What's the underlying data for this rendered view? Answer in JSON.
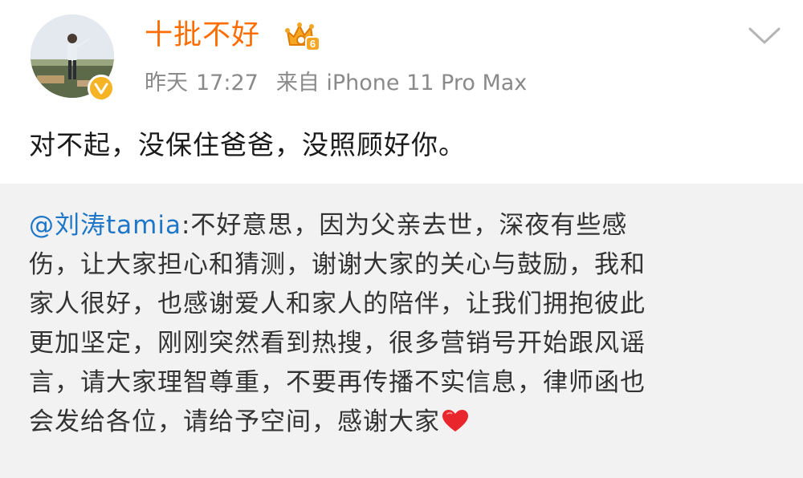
{
  "author": {
    "name": "十批不好",
    "vip_level": "6",
    "verified_icon": "verified-v-icon"
  },
  "meta": {
    "day": "昨天",
    "time": "17:27",
    "source": "来自 iPhone 11 Pro Max"
  },
  "post": {
    "text": "对不起，没保住爸爸，没照顾好你。"
  },
  "repost": {
    "mention": "@刘涛tamia",
    "lines": [
      ":不好意思，因为父亲去世，深夜有些感",
      "伤，让大家担心和猜测，谢谢大家的关心与鼓励，我和",
      "家人很好，也感谢爱人和家人的陪伴，让我们拥抱彼此",
      "更加坚定，刚刚突然看到热搜，很多营销号开始跟风谣",
      "言，请大家理智尊重，不要再传播不实信息，律师函也",
      "会发给各位，请给予空间，感谢大家"
    ],
    "emoji": "heart-emoji"
  },
  "colors": {
    "username": "#ff6d00",
    "mention": "#1d76c7",
    "meta": "#8a8a8a",
    "repost_bg": "#f2f2f2",
    "badge": "#f6b324",
    "heart": "#e8262b"
  }
}
